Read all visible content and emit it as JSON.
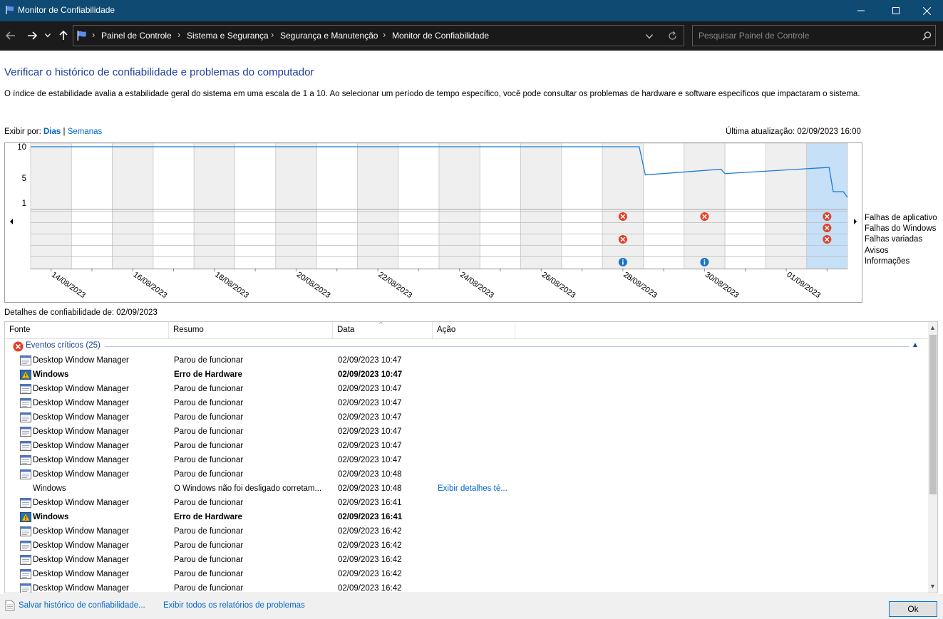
{
  "window": {
    "title": "Monitor de Confiabilidade",
    "minimize_icon": "minimize-icon",
    "maximize_icon": "maximize-icon",
    "close_icon": "close-icon"
  },
  "nav": {
    "breadcrumbs": [
      "Painel de Controle",
      "Sistema e Segurança",
      "Segurança e Manutenção",
      "Monitor de Confiabilidade"
    ],
    "search_placeholder": "Pesquisar Painel de Controle"
  },
  "header": {
    "title": "Verificar o histórico de confiabilidade e problemas do computador",
    "description": "O índice de estabilidade avalia a estabilidade geral do sistema em uma escala de 1 a 10. Ao selecionar um período de tempo específico, você pode consultar os problemas de hardware e software específicos que impactaram o sistema."
  },
  "view": {
    "label": "Exibir por:",
    "days": "Dias",
    "separator": "|",
    "weeks": "Semanas",
    "last_update": "Última atualização: 02/09/2023 16:00"
  },
  "chart_data": {
    "type": "line",
    "y_ticks": [
      "10",
      "5",
      "1"
    ],
    "ylim": [
      1,
      10
    ],
    "x_tick_labels": [
      "14/08/2023",
      "16/08/2023",
      "18/08/2023",
      "20/08/2023",
      "22/08/2023",
      "24/08/2023",
      "26/08/2023",
      "28/08/2023",
      "30/08/2023",
      "01/09/2023"
    ],
    "day_count": 20,
    "selected_day_index": 19,
    "stability_index": [
      {
        "day": 0,
        "value": 10
      },
      {
        "day": 14.9,
        "value": 10
      },
      {
        "day": 15.05,
        "value": 5.5
      },
      {
        "day": 16.9,
        "value": 6.4
      },
      {
        "day": 17.0,
        "value": 5.7
      },
      {
        "day": 19.55,
        "value": 6.7
      },
      {
        "day": 19.65,
        "value": 2.8
      },
      {
        "day": 19.9,
        "value": 2.8
      },
      {
        "day": 20.0,
        "value": 1.9
      }
    ],
    "event_rows": [
      "Falhas de aplicativo",
      "Falhas do Windows",
      "Falhas variadas",
      "Avisos",
      "Informações"
    ],
    "events": [
      {
        "row": 0,
        "day": 14,
        "kind": "error"
      },
      {
        "row": 2,
        "day": 14,
        "kind": "error"
      },
      {
        "row": 4,
        "day": 14,
        "kind": "info"
      },
      {
        "row": 0,
        "day": 16,
        "kind": "error"
      },
      {
        "row": 4,
        "day": 16,
        "kind": "info"
      },
      {
        "row": 0,
        "day": 19,
        "kind": "error"
      },
      {
        "row": 1,
        "day": 19,
        "kind": "error"
      },
      {
        "row": 2,
        "day": 19,
        "kind": "error"
      }
    ],
    "colors": {
      "line": "#1f7ad6",
      "selected": "#c6e0f7",
      "shade": "#efefef",
      "error": "#e0402a",
      "info": "#1a73c9"
    }
  },
  "details": {
    "label": "Detalhes de confiabilidade de: 02/09/2023",
    "columns": [
      "Fonte",
      "Resumo",
      "Data",
      "Ação"
    ],
    "group_label": "Eventos críticos (25)",
    "rows": [
      {
        "source": "Desktop Window Manager",
        "summary": "Parou de funcionar",
        "date": "02/09/2023 10:47",
        "action": "",
        "icon": "app-window-icon",
        "bold": false
      },
      {
        "source": "Windows",
        "summary": "Erro de Hardware",
        "date": "02/09/2023 10:47",
        "action": "",
        "icon": "windows-warning-icon",
        "bold": true
      },
      {
        "source": "Desktop Window Manager",
        "summary": "Parou de funcionar",
        "date": "02/09/2023 10:47",
        "action": "",
        "icon": "app-window-icon",
        "bold": false
      },
      {
        "source": "Desktop Window Manager",
        "summary": "Parou de funcionar",
        "date": "02/09/2023 10:47",
        "action": "",
        "icon": "app-window-icon",
        "bold": false
      },
      {
        "source": "Desktop Window Manager",
        "summary": "Parou de funcionar",
        "date": "02/09/2023 10:47",
        "action": "",
        "icon": "app-window-icon",
        "bold": false
      },
      {
        "source": "Desktop Window Manager",
        "summary": "Parou de funcionar",
        "date": "02/09/2023 10:47",
        "action": "",
        "icon": "app-window-icon",
        "bold": false
      },
      {
        "source": "Desktop Window Manager",
        "summary": "Parou de funcionar",
        "date": "02/09/2023 10:47",
        "action": "",
        "icon": "app-window-icon",
        "bold": false
      },
      {
        "source": "Desktop Window Manager",
        "summary": "Parou de funcionar",
        "date": "02/09/2023 10:47",
        "action": "",
        "icon": "app-window-icon",
        "bold": false
      },
      {
        "source": "Desktop Window Manager",
        "summary": "Parou de funcionar",
        "date": "02/09/2023 10:48",
        "action": "",
        "icon": "app-window-icon",
        "bold": false
      },
      {
        "source": "Windows",
        "summary": "O Windows não foi desligado corretam...",
        "date": "02/09/2023 10:48",
        "action": "Exibir detalhes té...",
        "icon": "",
        "bold": false
      },
      {
        "source": "Desktop Window Manager",
        "summary": "Parou de funcionar",
        "date": "02/09/2023 16:41",
        "action": "",
        "icon": "app-window-icon",
        "bold": false
      },
      {
        "source": "Windows",
        "summary": "Erro de Hardware",
        "date": "02/09/2023 16:41",
        "action": "",
        "icon": "windows-warning-icon",
        "bold": true
      },
      {
        "source": "Desktop Window Manager",
        "summary": "Parou de funcionar",
        "date": "02/09/2023 16:42",
        "action": "",
        "icon": "app-window-icon",
        "bold": false
      },
      {
        "source": "Desktop Window Manager",
        "summary": "Parou de funcionar",
        "date": "02/09/2023 16:42",
        "action": "",
        "icon": "app-window-icon",
        "bold": false
      },
      {
        "source": "Desktop Window Manager",
        "summary": "Parou de funcionar",
        "date": "02/09/2023 16:42",
        "action": "",
        "icon": "app-window-icon",
        "bold": false
      },
      {
        "source": "Desktop Window Manager",
        "summary": "Parou de funcionar",
        "date": "02/09/2023 16:42",
        "action": "",
        "icon": "app-window-icon",
        "bold": false
      },
      {
        "source": "Desktop Window Manager",
        "summary": "Parou de funcionar",
        "date": "02/09/2023 16:42",
        "action": "",
        "icon": "app-window-icon",
        "bold": false
      }
    ]
  },
  "footer": {
    "save_link": "Salvar histórico de confiabilidade...",
    "view_all_link": "Exibir todos os relatórios de problemas",
    "ok": "Ok"
  }
}
